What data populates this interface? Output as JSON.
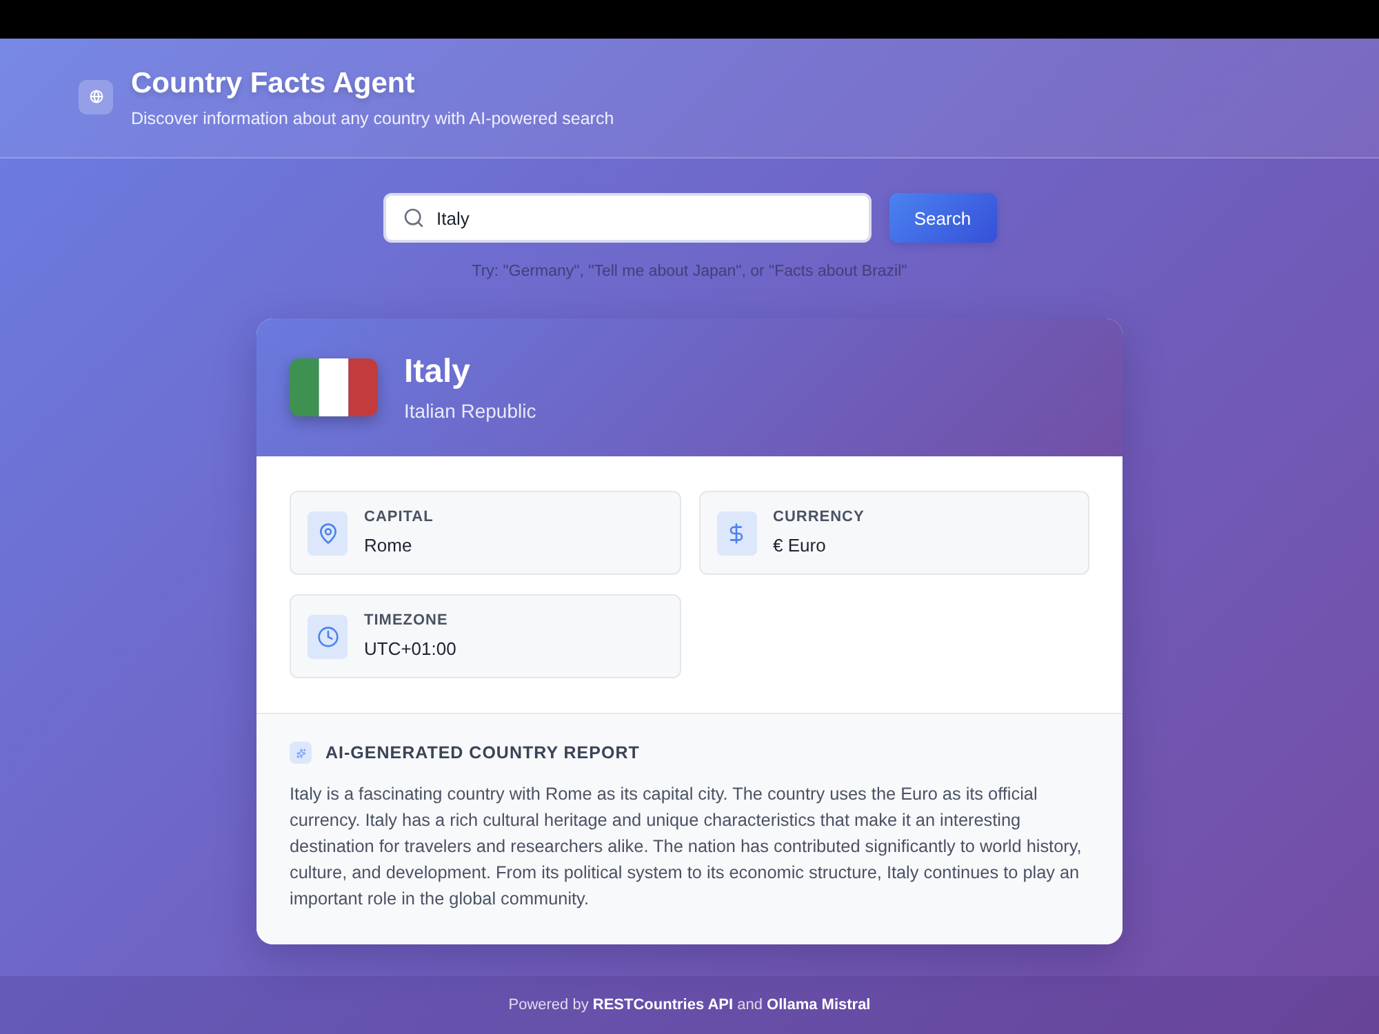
{
  "header": {
    "title": "Country Facts Agent",
    "subtitle": "Discover information about any country with AI-powered search"
  },
  "search": {
    "value": "Italy",
    "button": "Search",
    "hint": "Try: \"Germany\", \"Tell me about Japan\", or \"Facts about Brazil\""
  },
  "country": {
    "name": "Italy",
    "official_name": "Italian Republic"
  },
  "facts": [
    {
      "kind": "capital",
      "label": "CAPITAL",
      "value": "Rome"
    },
    {
      "kind": "currency",
      "label": "CURRENCY",
      "value": "€ Euro"
    },
    {
      "kind": "timezone",
      "label": "TIMEZONE",
      "value": "UTC+01:00"
    }
  ],
  "report": {
    "title": "AI-GENERATED COUNTRY REPORT",
    "text": "Italy is a fascinating country with Rome as its capital city. The country uses the Euro as its official currency. Italy has a rich cultural heritage and unique characteristics that make it an interesting destination for travelers and researchers alike. The nation has contributed significantly to world history, culture, and development. From its political system to its economic structure, Italy continues to play an important role in the global community."
  },
  "footer": {
    "text": "Powered by **RESTCountries API** and **Ollama Mistral**"
  }
}
